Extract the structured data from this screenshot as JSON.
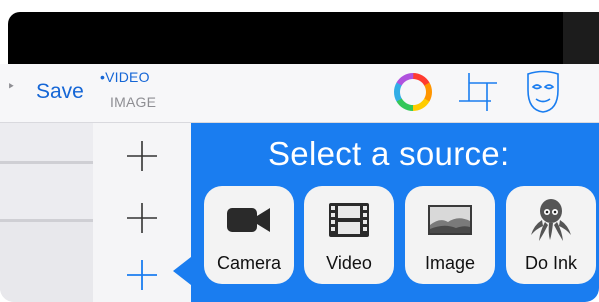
{
  "toolbar": {
    "save_label": "Save",
    "mode_video": "VIDEO",
    "mode_image": "IMAGE",
    "mode_selected_marker": "•",
    "back_glyph": "‣",
    "icons": [
      "color-wheel-icon",
      "crop-icon",
      "mask-icon"
    ]
  },
  "source_panel": {
    "title": "Select a source:",
    "sources": [
      {
        "label": "Camera",
        "icon": "video-camera-icon"
      },
      {
        "label": "Video",
        "icon": "film-strip-icon"
      },
      {
        "label": "Image",
        "icon": "landscape-image-icon"
      },
      {
        "label": "Do Ink",
        "icon": "octopus-icon"
      }
    ]
  },
  "add_buttons": {
    "count": 3,
    "active_index": 2
  },
  "colors": {
    "accent_blue": "#1a7df0",
    "link_blue": "#1566d6",
    "muted_gray": "#8e8e93",
    "topbar": "#000000"
  }
}
